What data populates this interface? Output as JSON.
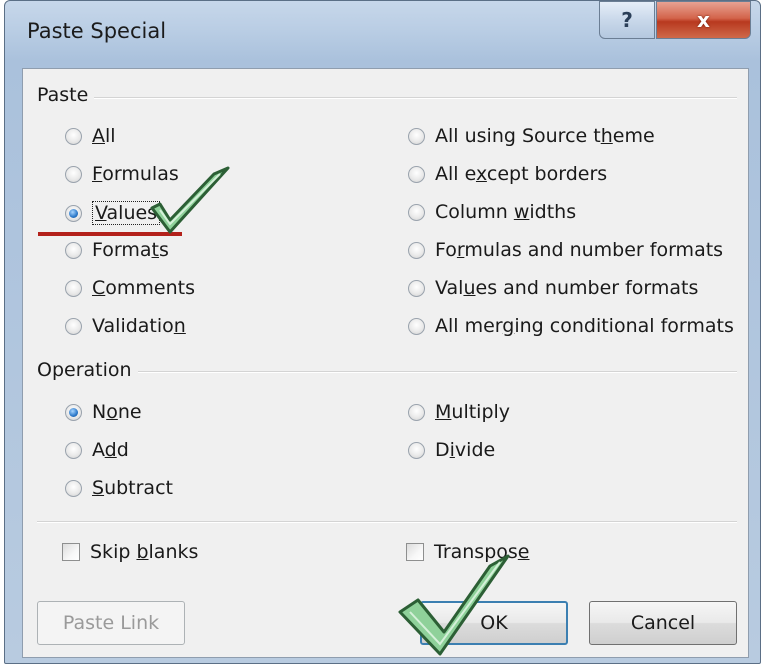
{
  "dialog": {
    "title": "Paste Special",
    "help_glyph": "?",
    "close_glyph": "x"
  },
  "paste_group": {
    "label": "Paste",
    "left_options": [
      {
        "pre": "",
        "u": "A",
        "post": "ll",
        "checked": false
      },
      {
        "pre": "",
        "u": "F",
        "post": "ormulas",
        "checked": false
      },
      {
        "pre": "",
        "u": "V",
        "post": "alues",
        "checked": true
      },
      {
        "pre": "Forma",
        "u": "t",
        "post": "s",
        "checked": false
      },
      {
        "pre": "",
        "u": "C",
        "post": "omments",
        "checked": false
      },
      {
        "pre": "Validatio",
        "u": "n",
        "post": "",
        "checked": false
      }
    ],
    "right_options": [
      {
        "pre": "All using Source t",
        "u": "h",
        "post": "eme",
        "checked": false
      },
      {
        "pre": "All e",
        "u": "x",
        "post": "cept borders",
        "checked": false
      },
      {
        "pre": "Column ",
        "u": "w",
        "post": "idths",
        "checked": false
      },
      {
        "pre": "Fo",
        "u": "r",
        "post": "mulas and number formats",
        "checked": false
      },
      {
        "pre": "Val",
        "u": "u",
        "post": "es and number formats",
        "checked": false
      },
      {
        "pre": "All mer",
        "u": "g",
        "post": "ing conditional formats",
        "checked": false
      }
    ]
  },
  "operation_group": {
    "label": "Operation",
    "left_options": [
      {
        "pre": "N",
        "u": "o",
        "post": "ne",
        "checked": true
      },
      {
        "pre": "A",
        "u": "d",
        "post": "d",
        "checked": false
      },
      {
        "pre": "",
        "u": "S",
        "post": "ubtract",
        "checked": false
      }
    ],
    "right_options": [
      {
        "pre": "",
        "u": "M",
        "post": "ultiply",
        "checked": false
      },
      {
        "pre": "D",
        "u": "i",
        "post": "vide",
        "checked": false
      }
    ]
  },
  "checkboxes": {
    "skip_blanks": {
      "pre": "Skip ",
      "u": "b",
      "post": "lanks",
      "checked": false
    },
    "transpose": {
      "pre": "Transpos",
      "u": "e",
      "post": "",
      "checked": false
    }
  },
  "buttons": {
    "paste_link": "Paste Link",
    "ok": "OK",
    "cancel": "Cancel"
  },
  "colors": {
    "annotation_red": "#b3211b",
    "checkmark_green": "#8fd19a"
  }
}
